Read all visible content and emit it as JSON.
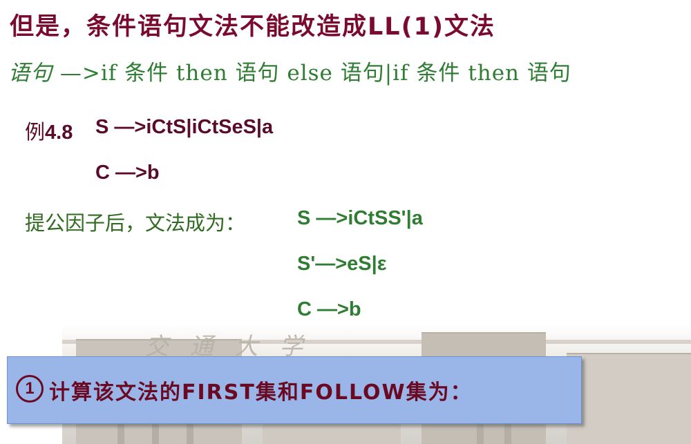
{
  "title": "但是，条件语句文法不能改造成LL(1)文法",
  "grammar_line": {
    "lead": "语句",
    "body": " —>if 条件 then 语句 else 语句|if 条件 then 语句"
  },
  "example": {
    "label_prefix": "例",
    "label_number": "4.8",
    "rule_s": "S —>iCtS|iCtSeS|a",
    "rule_c": "C —>b"
  },
  "after_factoring": {
    "label": "提公因子后，文法成为：",
    "rules": [
      "S —>iCtSS'|a",
      "S'—>eS|ε",
      "C —>b"
    ]
  },
  "campus_mark": "交 通 大 学",
  "step": {
    "number": "1",
    "text": "计算该文法的FIRST集和FOLLOW集为："
  },
  "colors": {
    "title": "#7a0a2e",
    "green": "#2e7d32",
    "box_fill": "#9ab5e8",
    "step_text": "#6a0a22"
  }
}
